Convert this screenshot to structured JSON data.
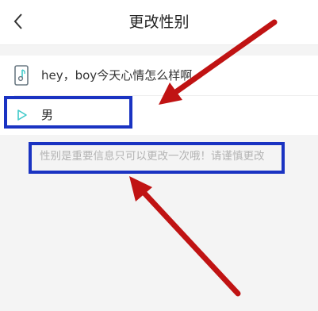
{
  "header": {
    "title": "更改性别",
    "back_icon": "chevron-left-icon"
  },
  "card": {
    "greeting": {
      "icon": "music-note-icon",
      "text": "hey，boy今天心情怎么样啊"
    },
    "option": {
      "icon": "play-triangle-icon",
      "label": "男"
    }
  },
  "note": "性别是重要信息只可以更改一次哦！请谨慎更改",
  "colors": {
    "highlight": "#1a33c2",
    "arrow": "#c01313",
    "accent": "#3ec9c9"
  }
}
